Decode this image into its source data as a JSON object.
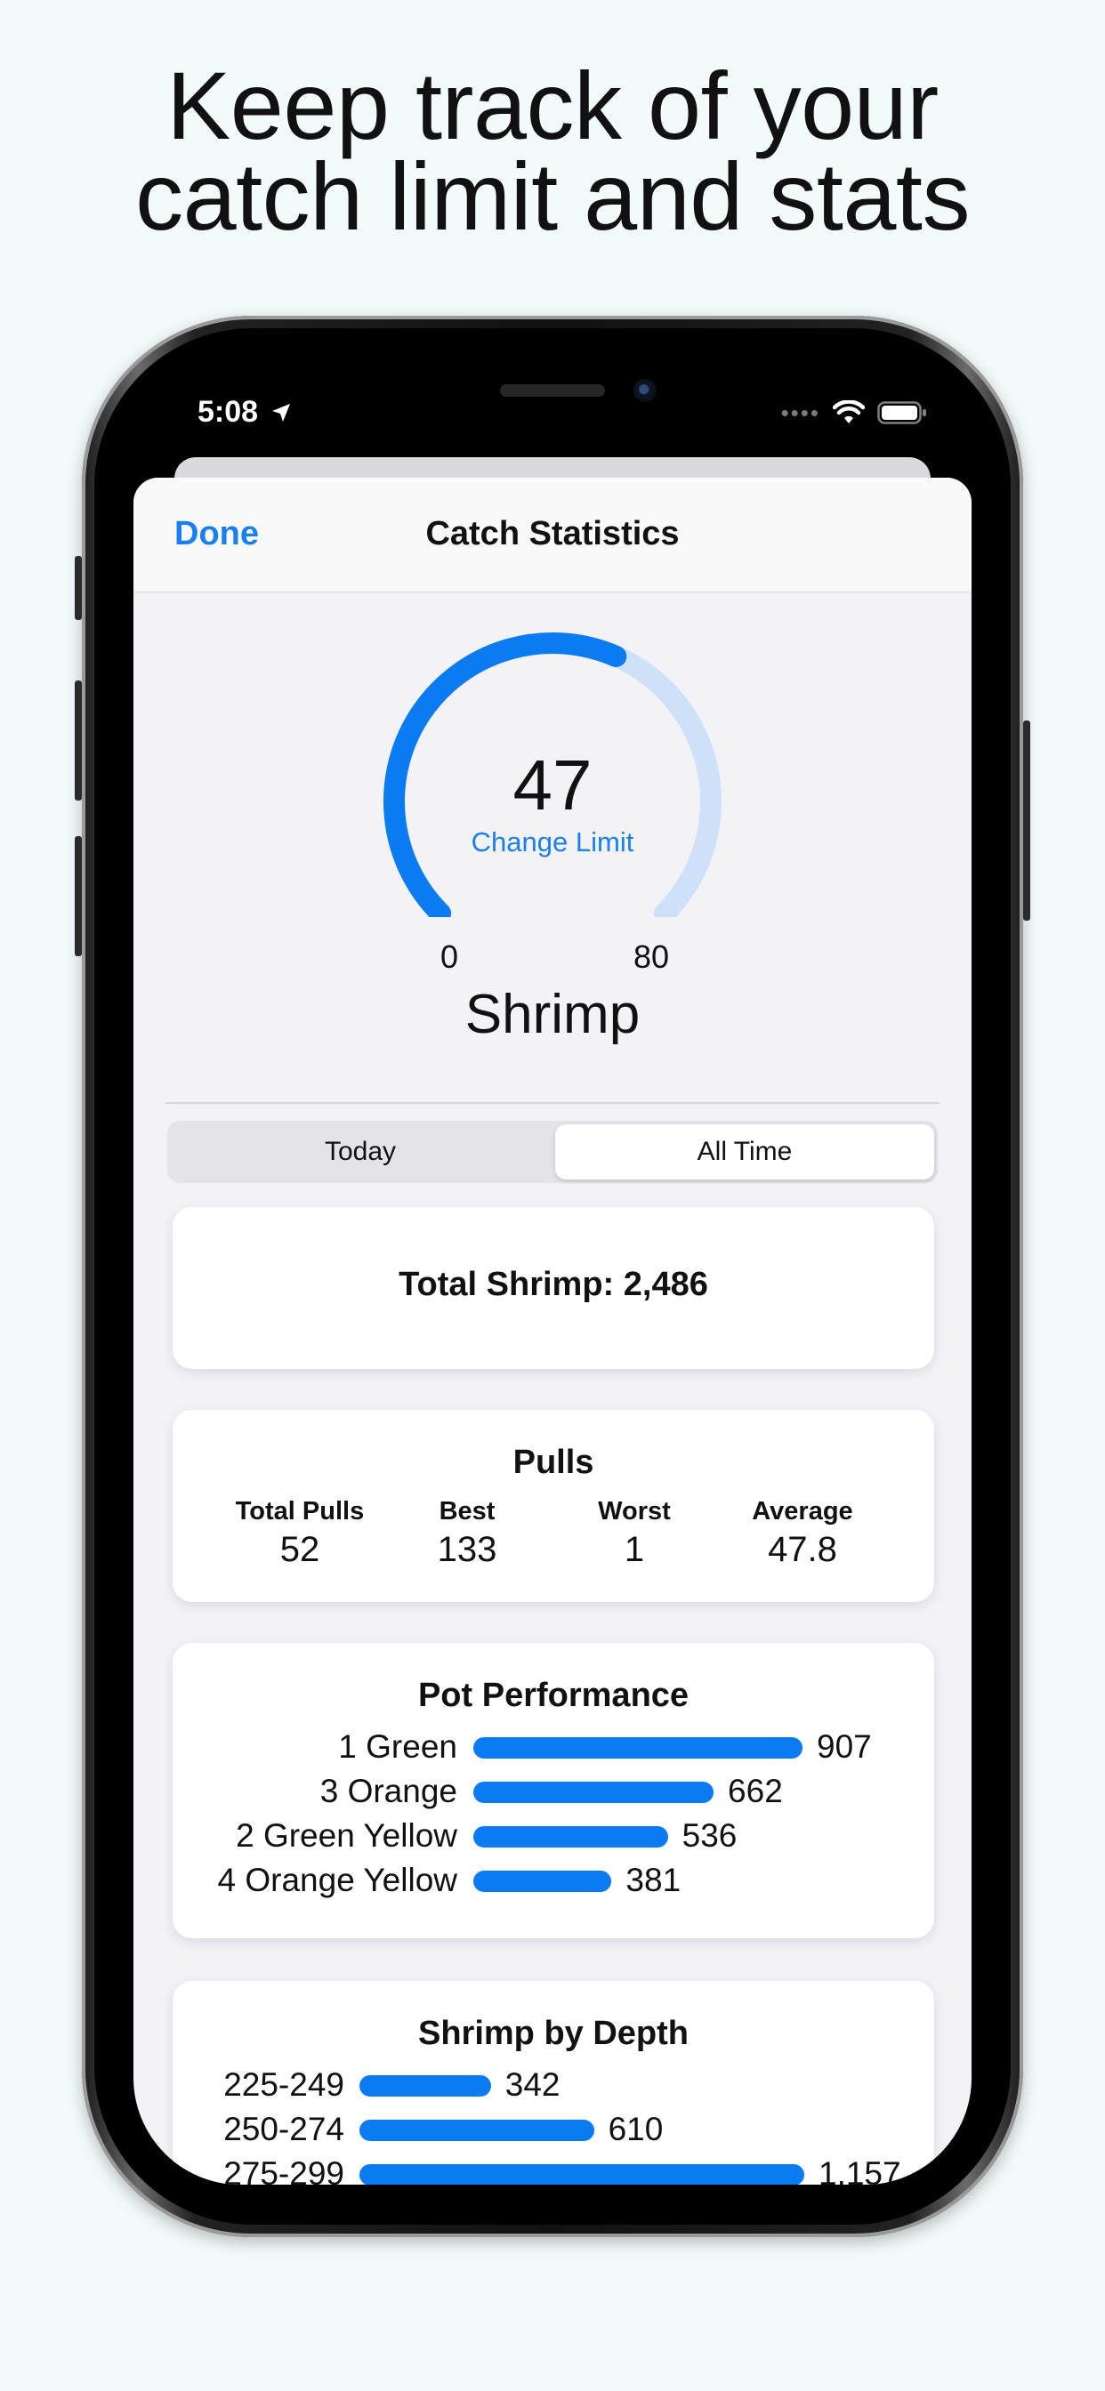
{
  "headline": {
    "line1": "Keep track of your",
    "line2": "catch limit and stats"
  },
  "status_bar": {
    "time": "5:08",
    "icons": [
      "location-arrow-icon",
      "cellular-dots-icon",
      "wifi-icon",
      "battery-icon"
    ]
  },
  "navbar": {
    "done_label": "Done",
    "title": "Catch Statistics"
  },
  "gauge": {
    "value": "47",
    "change_label": "Change Limit",
    "min": "0",
    "max": "80",
    "fill_fraction": 0.5875,
    "species": "Shrimp"
  },
  "segmented": {
    "options": [
      "Today",
      "All Time"
    ],
    "selected": "All Time"
  },
  "total_card": {
    "text": "Total Shrimp: 2,486"
  },
  "pulls_card": {
    "title": "Pulls",
    "stats": [
      {
        "label": "Total Pulls",
        "value": "52"
      },
      {
        "label": "Best",
        "value": "133"
      },
      {
        "label": "Worst",
        "value": "1"
      },
      {
        "label": "Average",
        "value": "47.8"
      }
    ]
  },
  "pot_card": {
    "title": "Pot Performance",
    "rows": [
      {
        "label": "1 Green",
        "value": 907
      },
      {
        "label": "3 Orange",
        "value": 662
      },
      {
        "label": "2 Green Yellow",
        "value": 536
      },
      {
        "label": "4 Orange Yellow",
        "value": 381
      }
    ]
  },
  "depth_card": {
    "title": "Shrimp by Depth",
    "rows": [
      {
        "label": "225-249",
        "value": 342
      },
      {
        "label": "250-274",
        "value": 610
      },
      {
        "label": "275-299",
        "value": 1157
      }
    ]
  },
  "colors": {
    "accent": "#1a7ff0",
    "bar": "#0a7bf2",
    "gauge_track": "#cfe1f8",
    "sheet_bg": "#f2f2f7",
    "page_bg": "#f3fafb"
  }
}
